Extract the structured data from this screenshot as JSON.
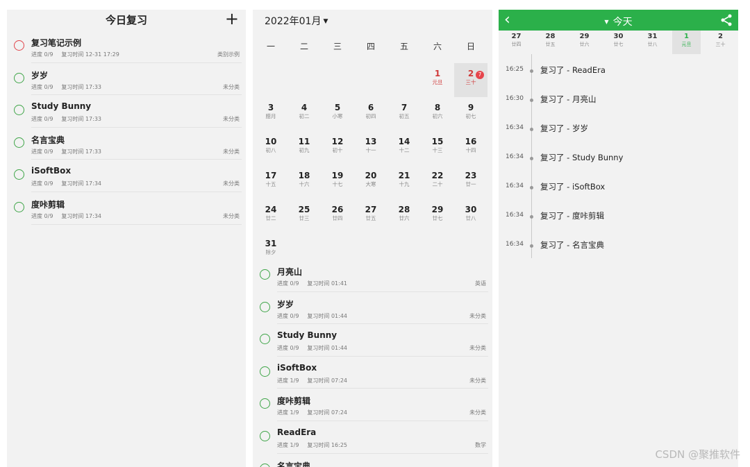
{
  "panel1": {
    "title": "今日复习",
    "add_icon": "plus-icon",
    "items": [
      {
        "name": "复习笔记示例",
        "progress": "进度 0/9",
        "time": "复习时间 12-31 17:29",
        "category": "类别示例",
        "status": "red"
      },
      {
        "name": "岁岁",
        "progress": "进度 0/9",
        "time": "复习时间 17:33",
        "category": "未分类",
        "status": "green"
      },
      {
        "name": "Study Bunny",
        "progress": "进度 0/9",
        "time": "复习时间 17:33",
        "category": "未分类",
        "status": "green"
      },
      {
        "name": "名言宝典",
        "progress": "进度 0/9",
        "time": "复习时间 17:33",
        "category": "未分类",
        "status": "green"
      },
      {
        "name": "iSoftBox",
        "progress": "进度 0/9",
        "time": "复习时间 17:34",
        "category": "未分类",
        "status": "green"
      },
      {
        "name": "度咔剪辑",
        "progress": "进度 0/9",
        "time": "复习时间 17:34",
        "category": "未分类",
        "status": "green"
      }
    ]
  },
  "panel2": {
    "month": "2022年01月",
    "weekdays": [
      "一",
      "二",
      "三",
      "四",
      "五",
      "六",
      "日"
    ],
    "days": [
      {
        "num": "",
        "lunar": ""
      },
      {
        "num": "",
        "lunar": ""
      },
      {
        "num": "",
        "lunar": ""
      },
      {
        "num": "",
        "lunar": ""
      },
      {
        "num": "",
        "lunar": ""
      },
      {
        "num": "1",
        "lunar": "元旦",
        "holiday": true
      },
      {
        "num": "2",
        "lunar": "三十",
        "holiday": true,
        "today": true,
        "badge": "7"
      },
      {
        "num": "3",
        "lunar": "腊月"
      },
      {
        "num": "4",
        "lunar": "初二"
      },
      {
        "num": "5",
        "lunar": "小寒"
      },
      {
        "num": "6",
        "lunar": "初四"
      },
      {
        "num": "7",
        "lunar": "初五"
      },
      {
        "num": "8",
        "lunar": "初六"
      },
      {
        "num": "9",
        "lunar": "初七"
      },
      {
        "num": "10",
        "lunar": "初八"
      },
      {
        "num": "11",
        "lunar": "初九"
      },
      {
        "num": "12",
        "lunar": "初十"
      },
      {
        "num": "13",
        "lunar": "十一"
      },
      {
        "num": "14",
        "lunar": "十二"
      },
      {
        "num": "15",
        "lunar": "十三"
      },
      {
        "num": "16",
        "lunar": "十四"
      },
      {
        "num": "17",
        "lunar": "十五"
      },
      {
        "num": "18",
        "lunar": "十六"
      },
      {
        "num": "19",
        "lunar": "十七"
      },
      {
        "num": "20",
        "lunar": "大寒"
      },
      {
        "num": "21",
        "lunar": "十九"
      },
      {
        "num": "22",
        "lunar": "二十"
      },
      {
        "num": "23",
        "lunar": "廿一"
      },
      {
        "num": "24",
        "lunar": "廿二"
      },
      {
        "num": "25",
        "lunar": "廿三"
      },
      {
        "num": "26",
        "lunar": "廿四"
      },
      {
        "num": "27",
        "lunar": "廿五"
      },
      {
        "num": "28",
        "lunar": "廿六"
      },
      {
        "num": "29",
        "lunar": "廿七"
      },
      {
        "num": "30",
        "lunar": "廿八"
      },
      {
        "num": "31",
        "lunar": "除夕"
      }
    ],
    "items": [
      {
        "name": "月亮山",
        "progress": "进度 0/9",
        "time": "复习时间 01:41",
        "category": "英语"
      },
      {
        "name": "岁岁",
        "progress": "进度 0/9",
        "time": "复习时间 01:44",
        "category": "未分类"
      },
      {
        "name": "Study Bunny",
        "progress": "进度 0/9",
        "time": "复习时间 01:44",
        "category": "未分类"
      },
      {
        "name": "iSoftBox",
        "progress": "进度 1/9",
        "time": "复习时间 07:24",
        "category": "未分类"
      },
      {
        "name": "度咔剪辑",
        "progress": "进度 1/9",
        "time": "复习时间 07:24",
        "category": "未分类"
      },
      {
        "name": "ReadEra",
        "progress": "进度 1/9",
        "time": "复习时间 16:25",
        "category": "数学"
      },
      {
        "name": "名言宝典",
        "progress": "",
        "time": "",
        "category": ""
      }
    ]
  },
  "panel3": {
    "title": "今天",
    "back_icon": "chevron-left-icon",
    "share_icon": "share-icon",
    "week": [
      {
        "num": "27",
        "lunar": "廿四"
      },
      {
        "num": "28",
        "lunar": "廿五"
      },
      {
        "num": "29",
        "lunar": "廿六"
      },
      {
        "num": "30",
        "lunar": "廿七"
      },
      {
        "num": "31",
        "lunar": "廿八"
      },
      {
        "num": "1",
        "lunar": "元旦",
        "selected": true
      },
      {
        "num": "2",
        "lunar": "三十"
      }
    ],
    "entries": [
      {
        "time": "16:25",
        "text": "复习了 - ReadEra"
      },
      {
        "time": "16:30",
        "text": "复习了 - 月亮山"
      },
      {
        "time": "16:34",
        "text": "复习了 - 岁岁"
      },
      {
        "time": "16:34",
        "text": "复习了 - Study Bunny"
      },
      {
        "time": "16:34",
        "text": "复习了 - iSoftBox"
      },
      {
        "time": "16:34",
        "text": "复习了 - 度咔剪辑"
      },
      {
        "time": "16:34",
        "text": "复习了 - 名言宝典"
      }
    ]
  },
  "watermark": "CSDN @聚推软件",
  "colors": {
    "accent_green": "#2bb04a",
    "circle_green": "#3fa548",
    "holiday_red": "#d03a3a",
    "panel_bg": "#f2f2f2"
  }
}
